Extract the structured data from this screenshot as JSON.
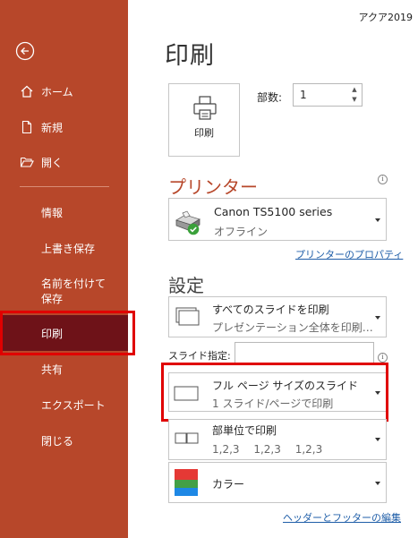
{
  "window": {
    "title": "アクア2019"
  },
  "page": {
    "title": "印刷"
  },
  "sidebar": {
    "home": "ホーム",
    "new": "新規",
    "open": "開く",
    "info": "情報",
    "save": "上書き保存",
    "save_as": "名前を付けて保存",
    "print": "印刷",
    "share": "共有",
    "export": "エクスポート",
    "close": "閉じる"
  },
  "print_button": {
    "label": "印刷"
  },
  "copies": {
    "label": "部数:",
    "value": "1"
  },
  "printer": {
    "heading": "プリンター",
    "name": "Canon TS5100 series",
    "status": "オフライン",
    "properties_link": "プリンターのプロパティ"
  },
  "settings": {
    "heading": "設定",
    "range": {
      "title": "すべてのスライドを印刷",
      "subtitle": "プレゼンテーション全体を印刷…"
    },
    "slides_label": "スライド指定:",
    "slides_value": "",
    "layout": {
      "title": "フル ページ サイズのスライド",
      "subtitle": "1 スライド/ページで印刷"
    },
    "collate": {
      "title": "部単位で印刷",
      "subtitle": "1,2,3　 1,2,3　 1,2,3"
    },
    "color": {
      "title": "カラー"
    },
    "header_footer_link": "ヘッダーとフッターの編集"
  },
  "colors": {
    "sidebar": "#b7472a",
    "selected": "#6e1218",
    "highlight": "#e00000",
    "link": "#1f5ea8"
  }
}
